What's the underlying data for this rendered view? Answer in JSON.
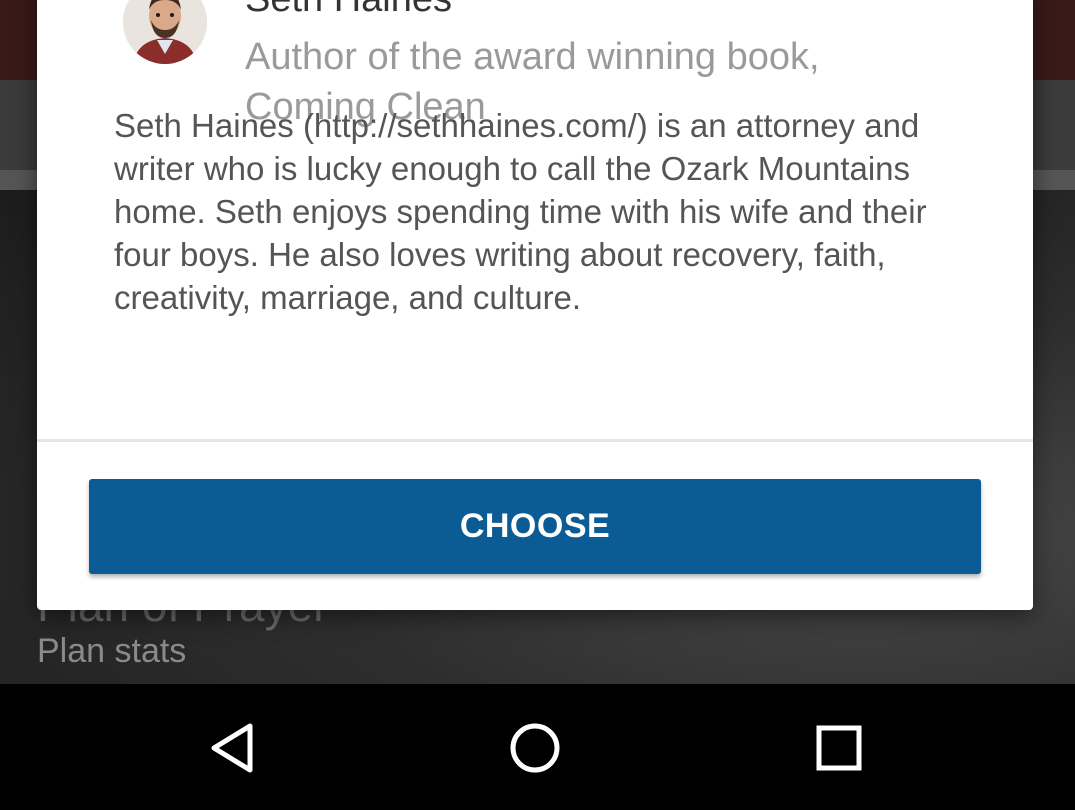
{
  "background": {
    "plan_title": "Plan of Prayer",
    "plan_stats_label": "Plan stats"
  },
  "dialog": {
    "author_name": "Seth Haines",
    "author_tagline": "Author of the award winning book, Coming Clean",
    "bio": "Seth Haines (http://sethhaines.com/) is an attorney and writer who is lucky enough to call the Ozark Mountains home. Seth enjoys spending time with his wife and their four boys. He also loves writing about recovery, faith, creativity, marriage, and culture.",
    "choose_label": "CHOOSE"
  },
  "nav_bar": {
    "buttons": [
      "back-icon",
      "home-icon",
      "recents-icon"
    ]
  },
  "colors": {
    "primary_button": "#0b5b94",
    "dialog_bg": "#ffffff",
    "scrim": "#3a3a3a",
    "nav_bar": "#000000"
  }
}
